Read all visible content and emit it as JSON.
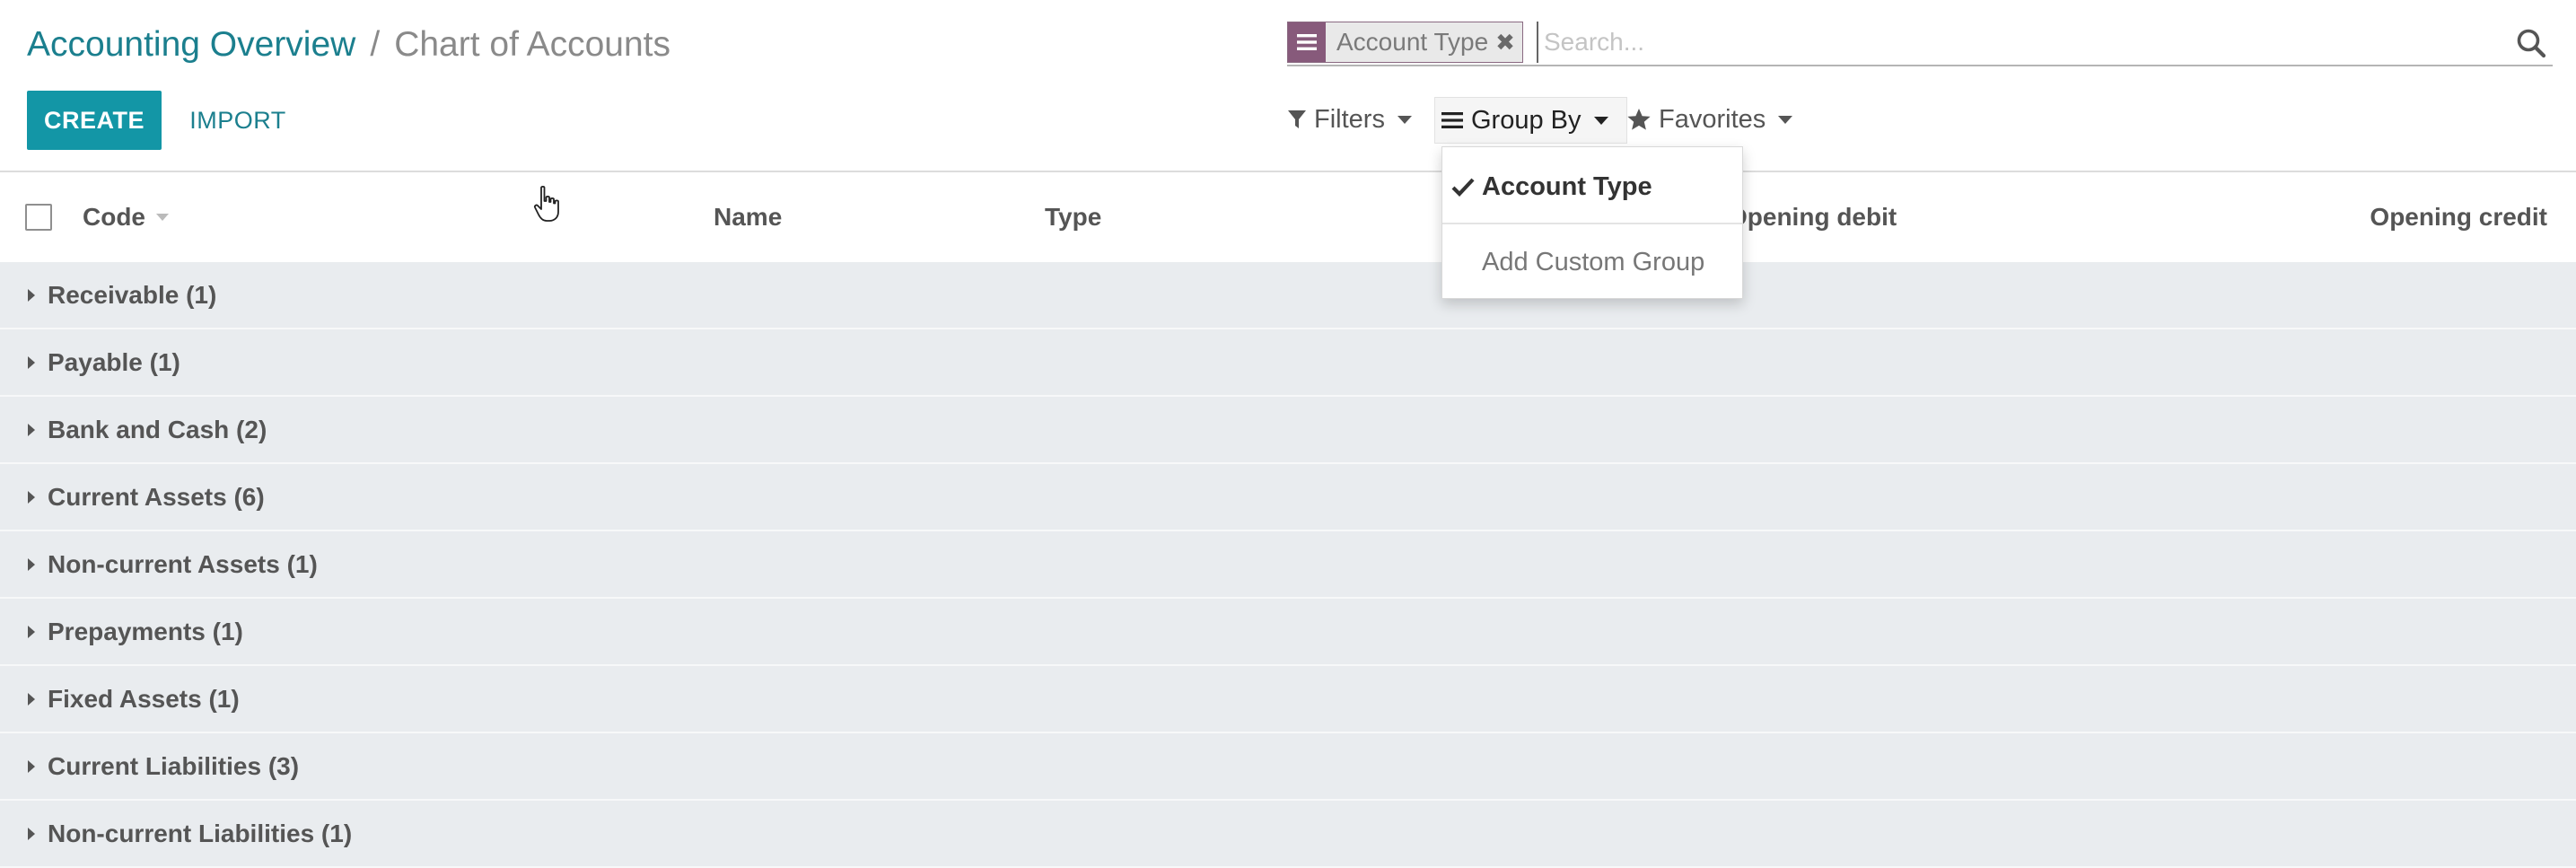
{
  "breadcrumb": {
    "parent": "Accounting Overview",
    "separator": "/",
    "current": "Chart of Accounts"
  },
  "buttons": {
    "create": "CREATE",
    "import": "IMPORT"
  },
  "search": {
    "facet_label": "Account Type",
    "facet_remove": "✖",
    "placeholder": "Search..."
  },
  "filter_bar": {
    "filters": "Filters",
    "group_by": "Group By",
    "favorites": "Favorites"
  },
  "groupby_menu": {
    "items": [
      {
        "label": "Account Type",
        "checked": true
      }
    ],
    "add_custom": "Add Custom Group"
  },
  "table": {
    "headers": {
      "code": "Code",
      "name": "Name",
      "type": "Type",
      "opening_debit": "Opening debit",
      "opening_credit": "Opening credit"
    },
    "groups": [
      "Receivable (1)",
      "Payable (1)",
      "Bank and Cash (2)",
      "Current Assets (6)",
      "Non-current Assets (1)",
      "Prepayments (1)",
      "Fixed Assets (1)",
      "Current Liabilities (3)",
      "Non-current Liabilities (1)"
    ]
  },
  "colors": {
    "brand": "#875a7b",
    "primary": "#1396a6",
    "link": "#1b7f8e",
    "group_bg": "#e9ecef"
  },
  "icons": [
    "list-icon",
    "search-icon",
    "filter-icon",
    "bars-icon",
    "star-icon",
    "check-icon",
    "caret-right-icon",
    "hand-cursor-icon"
  ]
}
